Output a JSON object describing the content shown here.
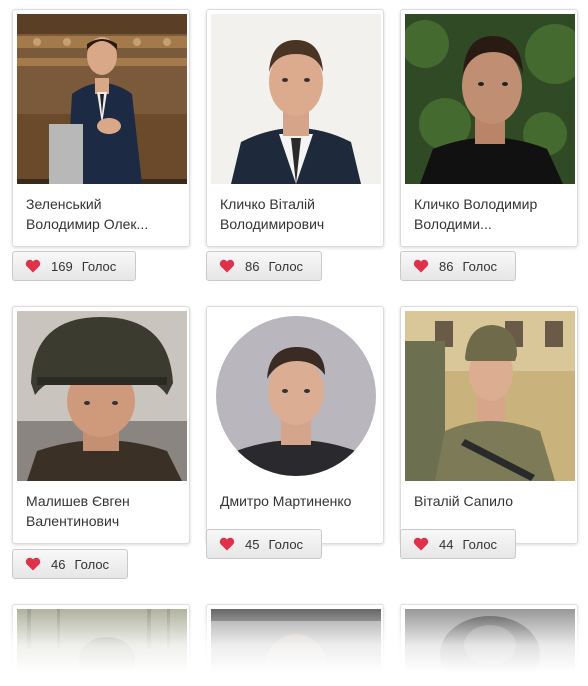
{
  "candidates": [
    {
      "name": "Зеленський Володимир Олек...",
      "votes": "169",
      "vote_label": "Голос"
    },
    {
      "name": "Кличко Віталій Володимирович",
      "votes": "86",
      "vote_label": "Голос"
    },
    {
      "name": "Кличко Володимир Володими...",
      "votes": "86",
      "vote_label": "Голос"
    },
    {
      "name": "Малишев Євген Валентинович",
      "votes": "46",
      "vote_label": "Голос"
    },
    {
      "name": "Дмитро Мартиненко",
      "votes": "45",
      "vote_label": "Голос"
    },
    {
      "name": "Віталій Сапило",
      "votes": "44",
      "vote_label": "Голос"
    }
  ],
  "colors": {
    "heart": "#e0314b",
    "border": "#dcdcdc",
    "button_border": "#c9c9c9"
  },
  "icons": {
    "vote": "heart-icon"
  }
}
